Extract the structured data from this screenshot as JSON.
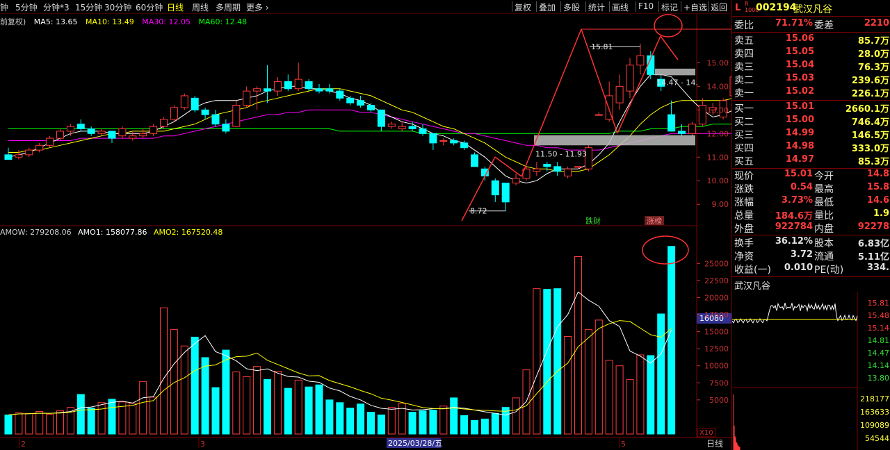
{
  "toolbar": {
    "periods": [
      "钟",
      "5分钟",
      "分钟*3",
      "15分钟",
      "30分钟",
      "60分钟",
      "日线",
      "周线",
      "多周期",
      "更多 ›"
    ],
    "active_period": "日线",
    "buttons": [
      "复权",
      "叠加",
      "多股",
      "统计",
      "画线",
      "F10",
      "标记",
      "+自选",
      "返回"
    ]
  },
  "main_legend": {
    "prefix": "前复权)",
    "ma5": "MA5: 13.65",
    "ma10": "MA10: 13.49",
    "ma30": "MA30: 12.05",
    "ma60": "MA60: 12.48"
  },
  "volume_legend": {
    "amow": "AMOW: 279208.06",
    "amo1": "AMO1: 158077.86",
    "amo2": "AMO2: 167520.48"
  },
  "annotations": {
    "high_label": "15.81",
    "low_label": "8.72",
    "band_upper": "14.47 - 14.",
    "band_lower": "11.50 - 11.93",
    "event1": "跌财",
    "event2": "涨榜",
    "vol_marker": "16080",
    "x10": "X10"
  },
  "x_axis": {
    "labels": [
      "2",
      "3",
      "2025/03/28/五",
      "5"
    ],
    "tab": "日线"
  },
  "colors": {
    "up": "#ff3b3b",
    "down": "#00ffff",
    "ma5": "#ffffff",
    "ma10": "#ffff00",
    "ma30": "#ff00ff",
    "ma60": "#00ff00"
  },
  "chart_data": [
    {
      "type": "candlestick",
      "ylim": [
        8.3,
        16.6
      ],
      "yticks": [
        "15.00",
        "14.00",
        "13.00",
        "12.00",
        "11.00",
        "10.00",
        "9.00"
      ],
      "candles": [
        {
          "o": 11.1,
          "h": 11.4,
          "l": 10.9,
          "c": 10.9
        },
        {
          "o": 11.0,
          "h": 11.3,
          "l": 10.9,
          "c": 11.1
        },
        {
          "o": 11.1,
          "h": 11.4,
          "l": 11.0,
          "c": 11.3
        },
        {
          "o": 11.3,
          "h": 11.6,
          "l": 11.2,
          "c": 11.5
        },
        {
          "o": 11.5,
          "h": 11.9,
          "l": 11.4,
          "c": 11.8
        },
        {
          "o": 11.8,
          "h": 12.2,
          "l": 11.7,
          "c": 12.1
        },
        {
          "o": 12.1,
          "h": 12.4,
          "l": 11.9,
          "c": 12.3
        },
        {
          "o": 12.4,
          "h": 12.6,
          "l": 12.1,
          "c": 12.2
        },
        {
          "o": 12.2,
          "h": 12.3,
          "l": 11.9,
          "c": 12.0
        },
        {
          "o": 12.0,
          "h": 12.2,
          "l": 11.9,
          "c": 12.1
        },
        {
          "o": 12.1,
          "h": 12.1,
          "l": 11.6,
          "c": 11.8
        },
        {
          "o": 11.9,
          "h": 12.3,
          "l": 11.8,
          "c": 12.2
        },
        {
          "o": 11.8,
          "h": 12.1,
          "l": 11.7,
          "c": 11.9
        },
        {
          "o": 11.9,
          "h": 12.2,
          "l": 11.8,
          "c": 12.0
        },
        {
          "o": 12.0,
          "h": 12.4,
          "l": 11.9,
          "c": 12.3
        },
        {
          "o": 12.3,
          "h": 12.7,
          "l": 12.2,
          "c": 12.6
        },
        {
          "o": 12.6,
          "h": 13.2,
          "l": 12.5,
          "c": 13.1
        },
        {
          "o": 13.1,
          "h": 13.7,
          "l": 13.0,
          "c": 13.6
        },
        {
          "o": 13.5,
          "h": 13.6,
          "l": 12.9,
          "c": 13.0
        },
        {
          "o": 13.0,
          "h": 13.1,
          "l": 12.6,
          "c": 12.8
        },
        {
          "o": 12.8,
          "h": 13.0,
          "l": 12.3,
          "c": 12.4
        },
        {
          "o": 12.4,
          "h": 12.6,
          "l": 12.0,
          "c": 12.1
        },
        {
          "o": 12.3,
          "h": 13.4,
          "l": 12.3,
          "c": 13.2
        },
        {
          "o": 13.2,
          "h": 14.0,
          "l": 13.1,
          "c": 13.8
        },
        {
          "o": 13.8,
          "h": 14.0,
          "l": 13.0,
          "c": 13.9
        },
        {
          "o": 13.9,
          "h": 14.9,
          "l": 13.3,
          "c": 13.8
        },
        {
          "o": 13.8,
          "h": 14.4,
          "l": 13.6,
          "c": 14.2
        },
        {
          "o": 14.2,
          "h": 14.5,
          "l": 13.8,
          "c": 13.9
        },
        {
          "o": 13.9,
          "h": 15.0,
          "l": 13.8,
          "c": 14.3
        },
        {
          "o": 14.2,
          "h": 14.3,
          "l": 13.8,
          "c": 13.9
        },
        {
          "o": 13.9,
          "h": 14.1,
          "l": 13.7,
          "c": 13.8
        },
        {
          "o": 13.9,
          "h": 14.1,
          "l": 13.7,
          "c": 13.8
        },
        {
          "o": 13.8,
          "h": 13.9,
          "l": 13.4,
          "c": 13.5
        },
        {
          "o": 13.5,
          "h": 13.6,
          "l": 13.2,
          "c": 13.3
        },
        {
          "o": 13.4,
          "h": 13.6,
          "l": 13.1,
          "c": 13.2
        },
        {
          "o": 13.2,
          "h": 13.3,
          "l": 12.9,
          "c": 13.0
        },
        {
          "o": 13.0,
          "h": 13.0,
          "l": 12.1,
          "c": 12.3
        },
        {
          "o": 12.3,
          "h": 12.5,
          "l": 12.2,
          "c": 12.4
        },
        {
          "o": 12.2,
          "h": 12.5,
          "l": 12.1,
          "c": 12.3
        },
        {
          "o": 12.3,
          "h": 12.5,
          "l": 12.1,
          "c": 12.2
        },
        {
          "o": 12.2,
          "h": 12.4,
          "l": 11.9,
          "c": 12.0
        },
        {
          "o": 12.0,
          "h": 12.0,
          "l": 11.3,
          "c": 11.6
        },
        {
          "o": 11.7,
          "h": 11.8,
          "l": 11.5,
          "c": 11.7
        },
        {
          "o": 11.7,
          "h": 11.8,
          "l": 11.5,
          "c": 11.6
        },
        {
          "o": 11.6,
          "h": 11.7,
          "l": 11.3,
          "c": 11.4
        },
        {
          "o": 11.1,
          "h": 11.2,
          "l": 10.6,
          "c": 10.6
        },
        {
          "o": 10.5,
          "h": 10.6,
          "l": 10.0,
          "c": 10.2
        },
        {
          "o": 10.0,
          "h": 10.1,
          "l": 9.1,
          "c": 9.4
        },
        {
          "o": 9.9,
          "h": 9.9,
          "l": 8.72,
          "c": 9.1
        },
        {
          "o": 9.9,
          "h": 10.3,
          "l": 9.8,
          "c": 10.1
        },
        {
          "o": 10.1,
          "h": 10.6,
          "l": 10.0,
          "c": 10.5
        },
        {
          "o": 10.4,
          "h": 10.8,
          "l": 10.2,
          "c": 10.5
        },
        {
          "o": 10.7,
          "h": 10.8,
          "l": 10.4,
          "c": 10.6
        },
        {
          "o": 10.6,
          "h": 10.8,
          "l": 10.2,
          "c": 10.4
        },
        {
          "o": 10.2,
          "h": 10.6,
          "l": 10.1,
          "c": 10.5
        },
        {
          "o": 10.6,
          "h": 10.6,
          "l": 10.5,
          "c": 10.6
        },
        {
          "o": 10.5,
          "h": 11.5,
          "l": 10.4,
          "c": 11.4
        },
        {
          "o": 12.8,
          "h": 12.9,
          "l": 12.8,
          "c": 12.8
        },
        {
          "o": 12.6,
          "h": 14.2,
          "l": 12.5,
          "c": 13.6
        },
        {
          "o": 13.3,
          "h": 14.5,
          "l": 13.0,
          "c": 14.0
        },
        {
          "o": 13.8,
          "h": 15.2,
          "l": 13.5,
          "c": 14.9
        },
        {
          "o": 14.9,
          "h": 15.81,
          "l": 14.5,
          "c": 15.3
        },
        {
          "o": 15.3,
          "h": 15.5,
          "l": 14.3,
          "c": 14.5
        },
        {
          "o": 14.3,
          "h": 14.5,
          "l": 13.8,
          "c": 14.0
        },
        {
          "o": 12.8,
          "h": 13.4,
          "l": 12.5,
          "c": 12.1
        },
        {
          "o": 12.1,
          "h": 12.4,
          "l": 11.9,
          "c": 12.0
        },
        {
          "o": 12.0,
          "h": 12.5,
          "l": 11.9,
          "c": 12.4
        },
        {
          "o": 12.4,
          "h": 13.5,
          "l": 12.3,
          "c": 13.2
        },
        {
          "o": 13.0,
          "h": 13.3,
          "l": 12.8,
          "c": 13.1
        },
        {
          "o": 12.7,
          "h": 13.5,
          "l": 12.6,
          "c": 13.4
        },
        {
          "o": 13.6,
          "h": 14.6,
          "l": 13.4,
          "c": 14.4
        },
        {
          "o": 14.6,
          "h": 15.2,
          "l": 14.5,
          "c": 15.01
        }
      ],
      "ma5": [
        11.0,
        11.1,
        11.2,
        11.4,
        11.6,
        11.8,
        12.0,
        12.1,
        12.1,
        12.1,
        12.0,
        12.0,
        12.0,
        12.0,
        12.1,
        12.3,
        12.5,
        12.8,
        13.1,
        13.3,
        13.4,
        13.4,
        13.4,
        13.5,
        13.6,
        13.8,
        13.9,
        14.0,
        14.0,
        13.9,
        13.9,
        13.8,
        13.7,
        13.5,
        13.4,
        13.2,
        12.9,
        12.7,
        12.5,
        12.4,
        12.2,
        12.0,
        11.9,
        11.7,
        11.6,
        11.3,
        11.0,
        10.6,
        10.2,
        10.0,
        9.9,
        10.0,
        10.3,
        10.5,
        10.5,
        10.5,
        10.7,
        11.1,
        11.6,
        12.5,
        13.3,
        14.0,
        14.5,
        14.5,
        14.4,
        13.9,
        13.4,
        13.0,
        12.7,
        12.8,
        13.0,
        13.6
      ],
      "ma10": [
        11.2,
        11.2,
        11.3,
        11.3,
        11.4,
        11.5,
        11.6,
        11.7,
        11.8,
        11.9,
        12.0,
        12.0,
        12.1,
        12.1,
        12.1,
        12.1,
        12.2,
        12.3,
        12.4,
        12.6,
        12.8,
        12.9,
        13.0,
        13.1,
        13.3,
        13.4,
        13.5,
        13.6,
        13.7,
        13.8,
        13.9,
        13.9,
        13.9,
        13.8,
        13.7,
        13.6,
        13.4,
        13.2,
        13.0,
        12.9,
        12.7,
        12.5,
        12.3,
        12.2,
        12.0,
        11.8,
        11.6,
        11.3,
        11.0,
        10.8,
        10.6,
        10.5,
        10.5,
        10.4,
        10.4,
        10.4,
        10.5,
        10.8,
        11.1,
        11.5,
        11.9,
        12.4,
        12.8,
        13.1,
        13.3,
        13.4,
        13.4,
        13.4,
        13.4,
        13.4,
        13.5,
        13.49
      ],
      "ma30": [
        11.7,
        11.7,
        11.7,
        11.7,
        11.7,
        11.7,
        11.7,
        11.8,
        11.8,
        11.8,
        11.8,
        11.8,
        11.8,
        11.8,
        11.8,
        11.9,
        11.9,
        12.0,
        12.1,
        12.2,
        12.3,
        12.4,
        12.5,
        12.6,
        12.7,
        12.8,
        12.8,
        12.9,
        12.9,
        13.0,
        13.0,
        13.0,
        13.0,
        13.0,
        12.9,
        12.9,
        12.8,
        12.7,
        12.6,
        12.5,
        12.4,
        12.3,
        12.2,
        12.1,
        12.0,
        12.0,
        11.9,
        11.8,
        11.7,
        11.6,
        11.5,
        11.5,
        11.4,
        11.4,
        11.3,
        11.3,
        11.3,
        11.3,
        11.4,
        11.5,
        11.6,
        11.7,
        11.8,
        11.9,
        12.0,
        12.0,
        12.0,
        12.0,
        12.0,
        12.0,
        12.0,
        12.05
      ],
      "ma60": [
        12.2,
        12.2,
        12.2,
        12.2,
        12.2,
        12.2,
        12.2,
        12.2,
        12.2,
        12.2,
        12.2,
        12.2,
        12.2,
        12.2,
        12.2,
        12.2,
        12.2,
        12.2,
        12.2,
        12.2,
        12.2,
        12.2,
        12.2,
        12.2,
        12.2,
        12.2,
        12.2,
        12.2,
        12.2,
        12.2,
        12.2,
        12.2,
        12.1,
        12.1,
        12.1,
        12.1,
        12.1,
        12.1,
        12.1,
        12.1,
        12.0,
        12.0,
        12.0,
        12.0,
        12.0,
        12.0,
        12.0,
        12.0,
        12.0,
        12.0,
        12.0,
        12.0,
        12.0,
        12.0,
        12.0,
        12.0,
        12.0,
        12.0,
        12.0,
        12.1,
        12.1,
        12.1,
        12.2,
        12.2,
        12.2,
        12.3,
        12.3,
        12.3,
        12.4,
        12.4,
        12.4,
        12.48
      ]
    },
    {
      "type": "bar",
      "ylim": [
        0,
        29000
      ],
      "yticks": [
        "25000",
        "22500",
        "20000",
        "17500",
        "15000",
        "12500",
        "10000",
        "7500",
        "5000"
      ],
      "values": [
        1800,
        1800,
        1800,
        1800,
        1800,
        1800,
        2200,
        2500,
        3400,
        3300,
        2700,
        2200,
        2500,
        2100,
        2300,
        3400,
        4800,
        4300,
        3800,
        3500,
        3900,
        5000,
        4200,
        4800,
        5000,
        6200,
        8600,
        4600,
        3700,
        2400,
        3000,
        2500,
        2600,
        2500,
        2200,
        2600,
        2400,
        2500,
        2400,
        2300,
        1900,
        2500,
        2000,
        2100,
        1900,
        1800,
        1700,
        2200,
        1800,
        1700,
        2100,
        2100,
        2200,
        1800,
        1700,
        1800,
        2200,
        1800,
        1700,
        2000,
        1800,
        1500,
        1400,
        2000,
        1900,
        1700,
        1800,
        2000,
        2600,
        2100,
        3000,
        5000,
        4500,
        3800,
        4300,
        3200,
        2500,
        2700,
        1900,
        1800,
        1800,
        1900,
        2800,
        2000,
        2500,
        2800,
        1600,
        2700,
        2600,
        1900,
        2700,
        3000,
        1500
      ],
      "vol": [
        2800,
        3100,
        3000,
        3300,
        2900,
        3400,
        3900,
        5800,
        3800,
        4600,
        5100,
        4700,
        4500,
        7700,
        5400,
        18500,
        15300,
        12900,
        14200,
        11200,
        6800,
        12300,
        9100,
        8400,
        9900,
        8000,
        9200,
        6700,
        7900,
        6900,
        7200,
        5000,
        4600,
        3800,
        4400,
        3200,
        2800,
        3900,
        4500,
        3200,
        3400,
        3500,
        4100,
        5300,
        2700,
        2000,
        2200,
        3000,
        3900,
        5300,
        9400,
        21300,
        21200,
        21300,
        14300,
        26000,
        15300,
        16700,
        10800,
        10000,
        8000,
        11600,
        11500,
        17600,
        27500
      ]
    }
  ],
  "side": {
    "code": "002194",
    "name": "武汉凡谷",
    "wb_label": "委比",
    "wb_value": "71.71%",
    "wc_label": "委差",
    "wc_value": "2210",
    "asks": [
      {
        "label": "卖五",
        "price": "15.06",
        "vol": "85.7万"
      },
      {
        "label": "卖四",
        "price": "15.05",
        "vol": "28.0万"
      },
      {
        "label": "卖三",
        "price": "15.04",
        "vol": "76.3万"
      },
      {
        "label": "卖二",
        "price": "15.03",
        "vol": "239.6万"
      },
      {
        "label": "卖一",
        "price": "15.02",
        "vol": "226.1万"
      }
    ],
    "bids": [
      {
        "label": "买一",
        "price": "15.01",
        "vol": "2660.1万"
      },
      {
        "label": "买二",
        "price": "15.00",
        "vol": "746.4万"
      },
      {
        "label": "买三",
        "price": "14.99",
        "vol": "146.5万"
      },
      {
        "label": "买四",
        "price": "14.98",
        "vol": "333.0万"
      },
      {
        "label": "买五",
        "price": "14.97",
        "vol": "85.3万"
      }
    ],
    "stats": [
      {
        "k1": "现价",
        "v1": "15.01",
        "k2": "今开",
        "v2": "14.8"
      },
      {
        "k1": "涨跌",
        "v1": "0.54",
        "k2": "最高",
        "v2": "15.8"
      },
      {
        "k1": "涨幅",
        "v1": "3.73%",
        "k2": "最低",
        "v2": "14.6"
      },
      {
        "k1": "总量",
        "v1": "184.6万",
        "k2": "量比",
        "v2": "1.9"
      },
      {
        "k1": "外盘",
        "v1": "922784",
        "k2": "内盘",
        "v2": "92278"
      }
    ],
    "stats2": [
      {
        "k1": "换手",
        "v1": "36.12%",
        "k2": "股本",
        "v2": "6.83亿"
      },
      {
        "k1": "净资",
        "v1": "3.72",
        "k2": "流通",
        "v2": "5.11亿"
      },
      {
        "k1": "收益(一)",
        "v1": "0.010",
        "k2": "PE(动)",
        "v2": "334."
      }
    ],
    "mini_title": "武汉凡谷",
    "mini_prices": [
      "15.81",
      "15.48",
      "15.14",
      "14.81",
      "14.47",
      "14.14",
      "13.80"
    ],
    "mini_vols": [
      "218177",
      "163633",
      "109089",
      "54544"
    ]
  }
}
